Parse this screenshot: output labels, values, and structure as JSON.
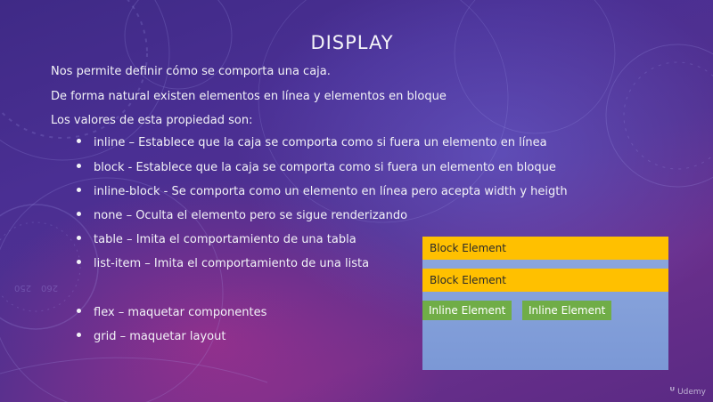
{
  "slide": {
    "title": "DISPLAY",
    "intro": [
      "Nos permite definir cómo se comporta una caja.",
      "De forma natural existen elementos en línea y elementos en bloque",
      "Los valores de esta propiedad son:"
    ],
    "values": [
      "inline – Establece que la caja se comporta como si fuera un elemento en línea",
      "block - Establece que la caja se comporta como si fuera un elemento en bloque",
      "inline-block - Se comporta como un elemento en línea pero acepta width y heigth",
      "none – Oculta el elemento pero se sigue renderizando",
      "table – Imita el comportamiento de una tabla",
      "list-item – Imita el comportamiento de una lista"
    ],
    "layout_values": [
      "flex – maquetar componentes",
      "grid – maquetar layout"
    ]
  },
  "demo": {
    "block_elements": [
      "Block Element",
      "Block Element"
    ],
    "inline_elements": [
      "Inline Element",
      "Inline Element"
    ],
    "colors": {
      "block": "#ffc000",
      "inline": "#70ad47",
      "container": "#8da8dd"
    }
  },
  "decoration": {
    "dial_numbers": [
      "260",
      "250"
    ]
  },
  "watermark": {
    "icon": "udemy-logo-icon",
    "text": "Udemy"
  }
}
